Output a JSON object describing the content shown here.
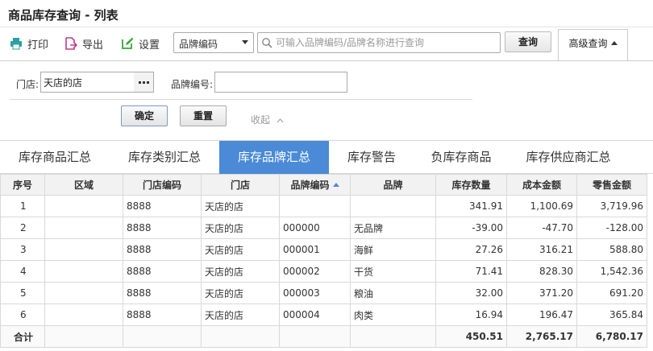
{
  "title": "商品库存查询 - 列表",
  "toolbar": {
    "print_label": "打印",
    "export_label": "导出",
    "settings_label": "设置",
    "search_type": "品牌编码",
    "search_placeholder": "可输入品牌编码/品牌名称进行查询",
    "query_label": "查询",
    "advanced_label": "高级查询"
  },
  "filters": {
    "store_label": "门店:",
    "store_value": "天店的店",
    "brand_code_label": "品牌编号:",
    "brand_code_value": "",
    "ok_label": "确定",
    "reset_label": "重置",
    "collapse_label": "收起"
  },
  "tabs": [
    {
      "label": "库存商品汇总"
    },
    {
      "label": "库存类别汇总"
    },
    {
      "label": "库存品牌汇总"
    },
    {
      "label": "库存警告"
    },
    {
      "label": "负库存商品"
    },
    {
      "label": "库存供应商汇总"
    }
  ],
  "active_tab": 2,
  "table": {
    "columns": [
      "序号",
      "区域",
      "门店编码",
      "门店",
      "品牌编码",
      "品牌",
      "库存数量",
      "成本金额",
      "零售金额"
    ],
    "sorted_column": 4,
    "rows": [
      [
        "1",
        "",
        "8888",
        "天店的店",
        "",
        "",
        "341.91",
        "1,100.69",
        "3,719.96"
      ],
      [
        "2",
        "",
        "8888",
        "天店的店",
        "000000",
        "无品牌",
        "-39.00",
        "-47.70",
        "-128.00"
      ],
      [
        "3",
        "",
        "8888",
        "天店的店",
        "000001",
        "海鲜",
        "27.26",
        "316.21",
        "588.80"
      ],
      [
        "4",
        "",
        "8888",
        "天店的店",
        "000002",
        "干货",
        "71.41",
        "828.30",
        "1,542.36"
      ],
      [
        "5",
        "",
        "8888",
        "天店的店",
        "000003",
        "粮油",
        "32.00",
        "371.20",
        "691.20"
      ],
      [
        "6",
        "",
        "8888",
        "天店的店",
        "000004",
        "肉类",
        "16.94",
        "196.47",
        "365.84"
      ]
    ],
    "total": [
      "合计",
      "",
      "",
      "",
      "",
      "",
      "450.51",
      "2,765.17",
      "6,780.17"
    ]
  },
  "colors": {
    "accent": "#4a8ad6",
    "print_icon": "#2aa0a4",
    "export_icon": "#c23a8a",
    "settings_icon": "#3aa53a"
  }
}
